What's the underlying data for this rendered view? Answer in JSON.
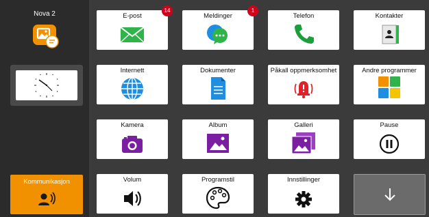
{
  "sidebar": {
    "profile_name": "Nova 2",
    "profile_icon": "gallery-chat-icon",
    "clock_icon": "analog-clock-icon",
    "communication_label": "Kommunikasjon",
    "communication_icon": "speaking-person-icon"
  },
  "tiles": [
    {
      "label": "E-post",
      "icon": "envelope-icon",
      "badge": "14"
    },
    {
      "label": "Meldinger",
      "icon": "chat-bubbles-icon",
      "badge": "1"
    },
    {
      "label": "Telefon",
      "icon": "phone-icon"
    },
    {
      "label": "Kontakter",
      "icon": "contacts-book-icon"
    },
    {
      "label": "Internett",
      "icon": "globe-icon"
    },
    {
      "label": "Dokumenter",
      "icon": "document-icon"
    },
    {
      "label": "Påkall oppmerksomhet",
      "icon": "alarm-bell-icon"
    },
    {
      "label": "Andre programmer",
      "icon": "apps-grid-icon"
    },
    {
      "label": "Kamera",
      "icon": "camera-icon"
    },
    {
      "label": "Album",
      "icon": "album-image-icon"
    },
    {
      "label": "Galleri",
      "icon": "gallery-images-icon"
    },
    {
      "label": "Pause",
      "icon": "pause-circle-icon"
    },
    {
      "label": "Volum",
      "icon": "speaker-volume-icon"
    },
    {
      "label": "Programstil",
      "icon": "palette-icon"
    },
    {
      "label": "Innstillinger",
      "icon": "gear-icon"
    }
  ],
  "navigation": {
    "down_icon": "arrow-down-icon"
  },
  "colors": {
    "accent_orange": "#f29100",
    "badge_red": "#d0021b",
    "email_green": "#2fb34a",
    "phone_green": "#1e9d3c",
    "globe_blue": "#1f8de0",
    "alarm_red": "#e0212a",
    "purple": "#7b1fa2"
  }
}
